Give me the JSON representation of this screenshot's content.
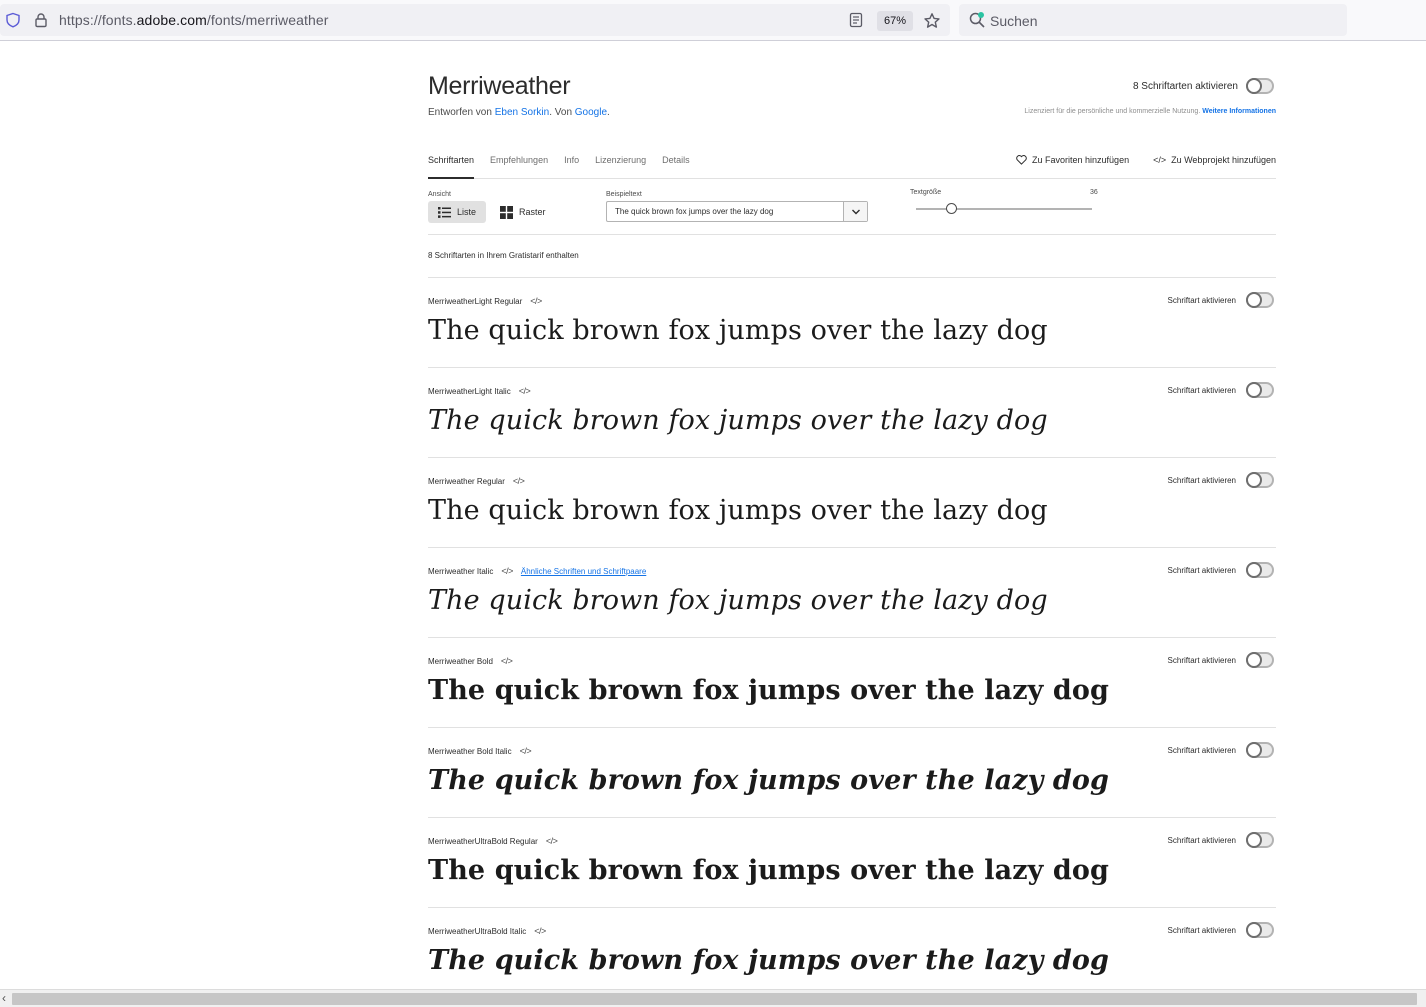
{
  "browser": {
    "url_prefix": "https://fonts.",
    "url_domain": "adobe.com",
    "url_path": "/fonts/merriweather",
    "zoom": "67%",
    "search_placeholder": "Suchen"
  },
  "header": {
    "title": "Merriweather",
    "designer_prefix": "Entworfen von ",
    "designer_name": "Eben Sorkin",
    "designer_mid": ". Von ",
    "foundry": "Google",
    "designer_suffix": ".",
    "activate_all": "8 Schriftarten aktivieren",
    "license_text": "Lizenziert für die persönliche und kommerzielle Nutzung. ",
    "license_link": "Weitere Informationen"
  },
  "tabs": [
    "Schriftarten",
    "Empfehlungen",
    "Info",
    "Lizenzierung",
    "Details"
  ],
  "tab_actions": {
    "favorites": "Zu Favoriten hinzufügen",
    "webproject": "Zu Webprojekt hinzufügen"
  },
  "controls": {
    "view_label": "Ansicht",
    "view_list": "Liste",
    "view_grid": "Raster",
    "sample_label": "Beispieltext",
    "sample_value": "The quick brown fox jumps over the lazy dog",
    "size_label": "Textgröße",
    "size_value": "36",
    "size_slider_fraction": 0.2
  },
  "count_text": "8 Schriftarten in Ihrem Gratistarif enthalten",
  "row_activate_label": "Schriftart aktivieren",
  "fonts": [
    {
      "name": "MerriweatherLight Regular",
      "sample": "The quick brown fox jumps over the lazy dog",
      "similar": ""
    },
    {
      "name": "MerriweatherLight Italic",
      "sample": "The quick brown fox jumps over the lazy dog",
      "similar": ""
    },
    {
      "name": "Merriweather Regular",
      "sample": "The quick brown fox jumps over the lazy dog",
      "similar": ""
    },
    {
      "name": "Merriweather Italic",
      "sample": "The quick brown fox jumps over the lazy dog",
      "similar": "Ähnliche Schriften und Schriftpaare"
    },
    {
      "name": "Merriweather Bold",
      "sample": "The quick brown fox jumps over the lazy dog",
      "similar": ""
    },
    {
      "name": "Merriweather Bold Italic",
      "sample": "The quick brown fox jumps over the lazy dog",
      "similar": ""
    },
    {
      "name": "MerriweatherUltraBold Regular",
      "sample": "The quick brown fox jumps over the lazy dog",
      "similar": ""
    },
    {
      "name": "MerriweatherUltraBold Italic",
      "sample": "The quick brown fox jumps over the lazy dog",
      "similar": ""
    }
  ],
  "colors": {
    "accent_link": "#1473e6",
    "text": "#2c2c2c",
    "divider": "#e1e1e1"
  },
  "icons": [
    "shield-icon",
    "lock-icon",
    "reader-view-icon",
    "bookmark-star-icon",
    "search-icon",
    "list-view-icon",
    "grid-view-icon",
    "chevron-down-icon",
    "heart-icon",
    "code-icon",
    "scroll-left-arrow-icon"
  ]
}
